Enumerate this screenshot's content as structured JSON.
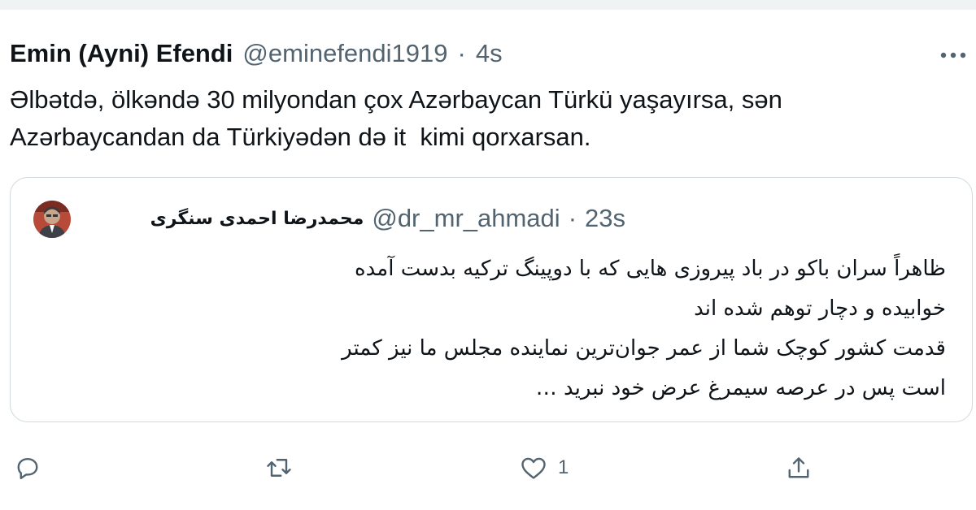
{
  "tweet": {
    "display_name": "Emin (Ayni) Efendi",
    "handle": "@eminefendi1919",
    "separator": "·",
    "time": "4s",
    "text_lines": [
      "Əlbətdə, ölkəndə 30 milyondan çox Azərbaycan Türkü yaşayırsa, sən",
      "Azərbaycandan da Türkiyədən də it  kimi qorxarsan."
    ]
  },
  "quoted_tweet": {
    "display_name": "محمدرضا احمدی سنگری",
    "handle": "@dr_mr_ahmadi",
    "separator": "·",
    "time": "23s",
    "text_lines": [
      "ظاهراً سران باکو در باد پیروزی هایی که با دوپینگ ترکیه بدست آمده",
      "خوابیده و دچار توهم شده اند",
      "قدمت کشور کوچک شما از عمر جوان‌ترین نماینده مجلس ما نیز کمتر",
      "است پس در عرصه سیمرغ عرض خود نبرید …"
    ]
  },
  "actions": {
    "like_count": "1"
  },
  "icons": {
    "more": "more-icon",
    "reply": "reply-icon",
    "retweet": "retweet-icon",
    "like": "like-icon",
    "share": "share-icon"
  },
  "colors": {
    "text": "#0f1419",
    "secondary": "#536471",
    "border": "#cfd9de"
  }
}
